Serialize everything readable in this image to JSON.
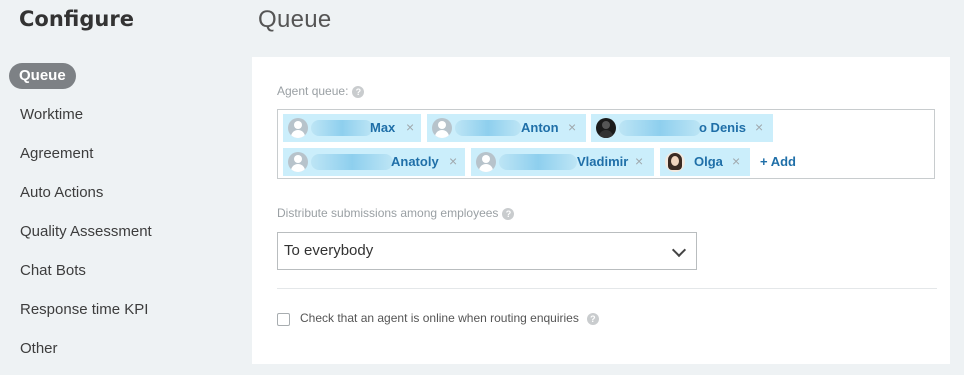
{
  "sidebar": {
    "title": "Configure",
    "items": [
      {
        "label": "Queue",
        "active": true
      },
      {
        "label": "Worktime"
      },
      {
        "label": "Agreement"
      },
      {
        "label": "Auto Actions"
      },
      {
        "label": "Quality Assessment"
      },
      {
        "label": "Chat Bots"
      },
      {
        "label": "Response time KPI"
      },
      {
        "label": "Other"
      }
    ]
  },
  "main": {
    "title": "Queue",
    "agent_queue": {
      "label": "Agent queue:",
      "help_icon": "?",
      "agents": [
        {
          "name": "Max",
          "avatar": "default-avatar-icon"
        },
        {
          "name": "Anton",
          "avatar": "default-avatar-icon"
        },
        {
          "name": "o Denis",
          "avatar": "photo-avatar-icon"
        },
        {
          "name": "Anatoly",
          "avatar": "default-avatar-icon"
        },
        {
          "name": "Vladimir",
          "avatar": "default-avatar-icon"
        },
        {
          "name": "Olga",
          "avatar": "photo-avatar-icon"
        }
      ],
      "remove_icon": "×",
      "add_label": "+ Add"
    },
    "distribute": {
      "label": "Distribute submissions among employees",
      "help_icon": "?",
      "selected": "To everybody"
    },
    "online_check": {
      "label": "Check that an agent is online when routing enquiries",
      "checked": false,
      "help_icon": "?"
    }
  },
  "colors": {
    "background": "#eef2f4",
    "tag_background": "#cbeefb",
    "tag_text": "#1f6fa8",
    "active_nav": "#7d8185"
  }
}
